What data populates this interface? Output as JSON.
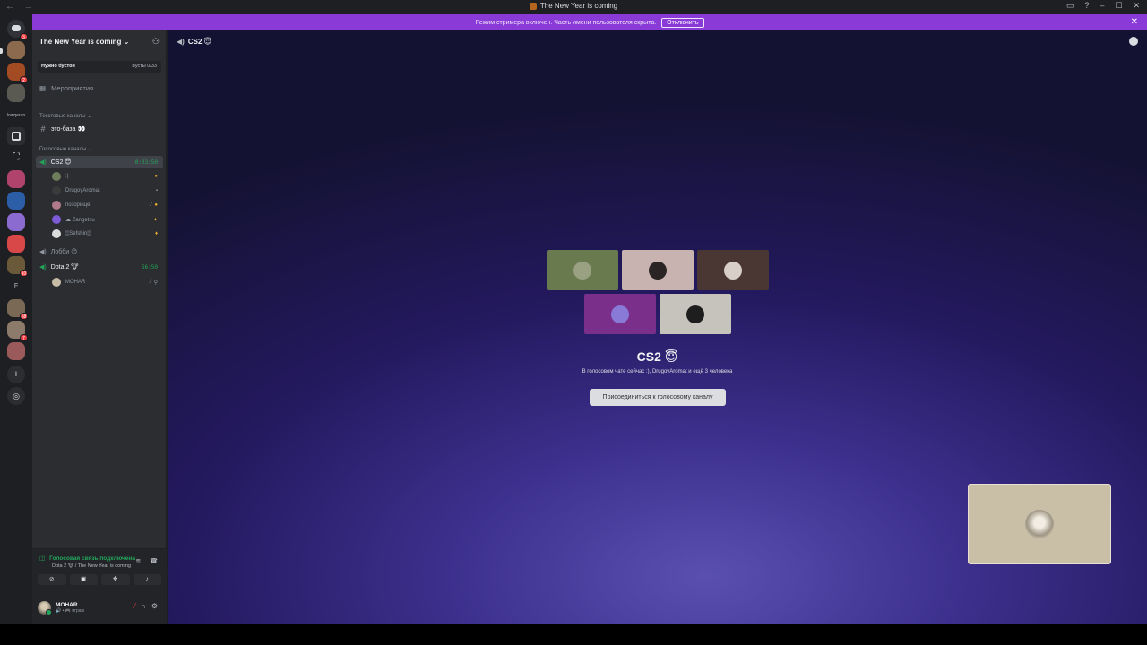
{
  "window": {
    "title": "The New Year is coming",
    "nav": "← →"
  },
  "banner": {
    "text": "Режим стримера включен. Часть имени пользователя скрыта.",
    "button": "Отключить"
  },
  "rail": {
    "mid_label": "lowqeran",
    "letter_label": "F",
    "badges": [
      "3",
      "2",
      "10",
      "58",
      "7"
    ]
  },
  "server": {
    "name": "The New Year is coming",
    "boost": {
      "label": "Нужно бустов",
      "progress": "Бусты 0/33"
    },
    "events": "Мероприятия",
    "text_category": "Текстовые каналы",
    "voice_category": "Голосовые каналы",
    "text_channels": [
      {
        "name": "это-база 👀"
      }
    ],
    "voice_channels": [
      {
        "name": "CS2 😇",
        "timer": "0:03:50",
        "users": [
          {
            "name": ":)",
            "color": "#6f7d5c"
          },
          {
            "name": "DrugoyAromat",
            "color": "#3b3b3b"
          },
          {
            "name": "позорище",
            "color": "#b07a8a"
          },
          {
            "name": "☁ Zangetsu",
            "color": "#7d5bd6"
          },
          {
            "name": "▒Sefshin▒",
            "color": "#dcdcdc"
          }
        ]
      },
      {
        "name": "Лобби 😊"
      },
      {
        "name": "Dota 2 🐮",
        "timer": "56:50",
        "users": [
          {
            "name": "МОНАR",
            "color": "#c7bca6"
          }
        ]
      }
    ]
  },
  "voice_panel": {
    "status": "Голосовая связь подключена",
    "location": "Dota 2 🐮 / The New Year is coming"
  },
  "user": {
    "name": "МОНАR",
    "status": "🔊 • 🎮 играю"
  },
  "main": {
    "channel": "CS2 😇",
    "title": "CS2 😇",
    "subtitle": "В голосовом чате сейчас :), DrugoyAromat и ещё 3 человека",
    "join_button": "Присоединиться к голосовому каналу",
    "tiles": [
      {
        "bg": "#6a7a4f",
        "av": "#9aa082"
      },
      {
        "bg": "#c9b3b0",
        "av": "#2a2424"
      },
      {
        "bg": "#4a3632",
        "av": "#d8cfc8"
      },
      {
        "bg": "#7a2f8a",
        "av": "#8a7ad8"
      },
      {
        "bg": "#c6c3bd",
        "av": "#1e1e1e"
      }
    ]
  }
}
